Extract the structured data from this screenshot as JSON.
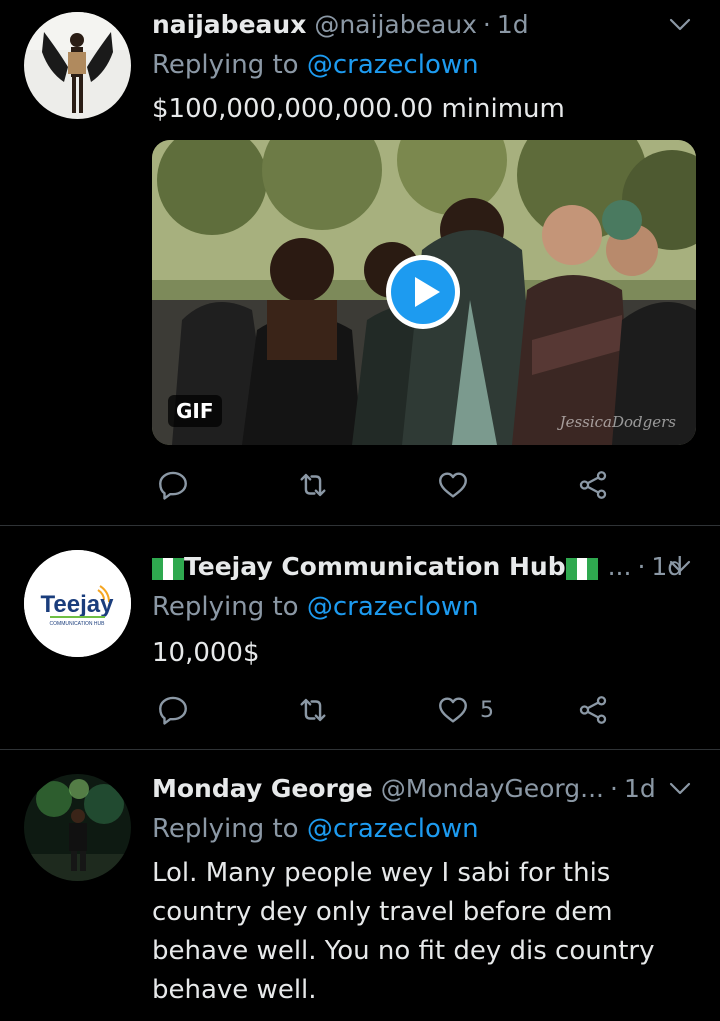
{
  "tweets": [
    {
      "name": "naijabeaux",
      "handle": "@naijabeaux",
      "dot": "·",
      "time": "1d",
      "replying_prefix": "Replying to",
      "replying_to": "@crazeclown",
      "text": "$100,000,000,000.00 minimum",
      "media": {
        "badge": "GIF",
        "watermark": "JessicaDodgers"
      },
      "likes": ""
    },
    {
      "name_flag_left": "🇳🇬",
      "name": "Teejay Communication Hub",
      "name_flag_right": "🇳🇬",
      "truncation": "...",
      "dot": "·",
      "time": "1d",
      "replying_prefix": "Replying to",
      "replying_to": "@crazeclown",
      "text": "10,000$",
      "logo_main": "Teejay",
      "logo_sub": "COMMUNICATION HUB",
      "likes": "5"
    },
    {
      "name": "Monday George",
      "handle": "@MondayGeorg...",
      "dot": "·",
      "time": "1d",
      "replying_prefix": "Replying to",
      "replying_to": "@crazeclown",
      "text": "Lol. Many people wey I sabi for this country dey only travel before dem behave well. You no fit dey dis country behave well.",
      "likes": ""
    }
  ],
  "colors": {
    "background": "#000000",
    "text": "#e7e9ea",
    "muted": "#8b98a5",
    "accent": "#1d9bf0",
    "divider": "#2f3336"
  },
  "icons": [
    "reply-icon",
    "retweet-icon",
    "like-icon",
    "share-icon",
    "chevron-down-icon",
    "play-icon"
  ]
}
